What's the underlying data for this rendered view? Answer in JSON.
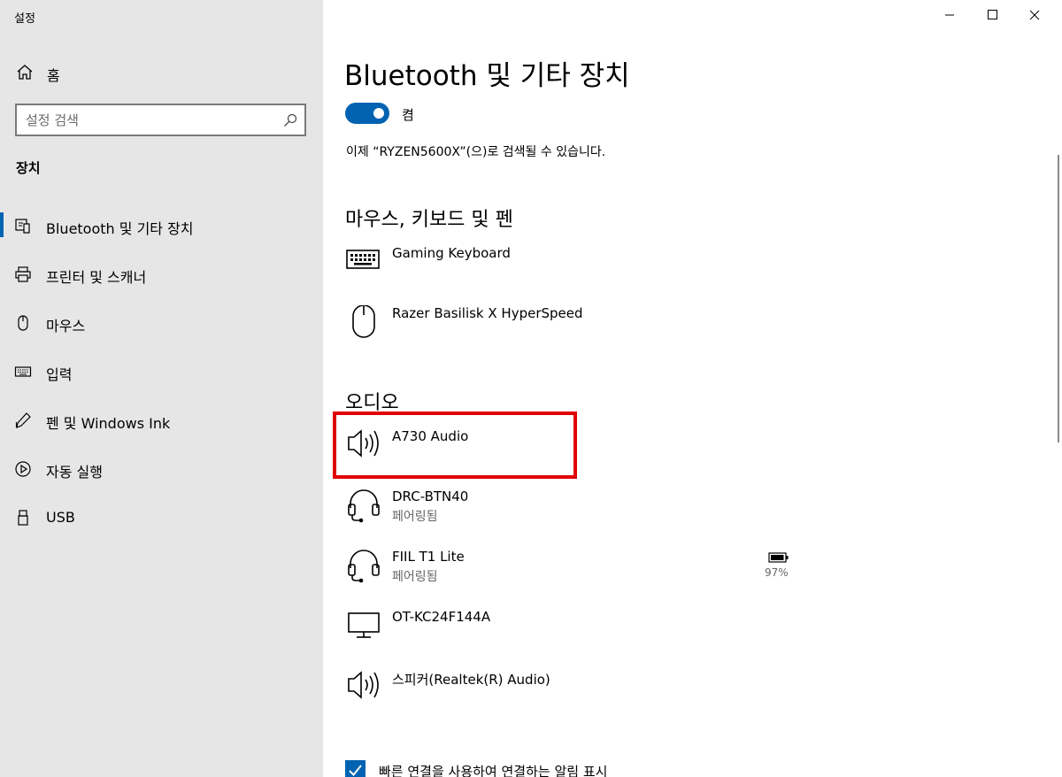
{
  "window": {
    "app_title": "설정"
  },
  "sidebar": {
    "home_label": "홈",
    "search_placeholder": "설정 검색",
    "section_heading": "장치",
    "items": [
      {
        "label": "Bluetooth 및 기타 장치",
        "icon": "bluetooth-devices-icon",
        "active": true
      },
      {
        "label": "프린터 및 스캐너",
        "icon": "printer-icon",
        "active": false
      },
      {
        "label": "마우스",
        "icon": "mouse-icon",
        "active": false
      },
      {
        "label": "입력",
        "icon": "keyboard-icon",
        "active": false
      },
      {
        "label": "펜 및 Windows Ink",
        "icon": "pen-icon",
        "active": false
      },
      {
        "label": "자동 실행",
        "icon": "autoplay-icon",
        "active": false
      },
      {
        "label": "USB",
        "icon": "usb-icon",
        "active": false
      }
    ]
  },
  "main": {
    "title": "Bluetooth 및 기타 장치",
    "bluetooth_toggle": {
      "label": "켬",
      "on": true
    },
    "discoverable_text": "이제 “RYZEN5600X”(으)로 검색될 수 있습니다.",
    "groups": [
      {
        "title": "마우스, 키보드 및 펜",
        "devices": [
          {
            "name": "Gaming Keyboard",
            "status": "",
            "icon": "keyboard-icon"
          },
          {
            "name": "Razer Basilisk X HyperSpeed",
            "status": "",
            "icon": "mouse-icon"
          }
        ]
      },
      {
        "title": "오디오",
        "devices": [
          {
            "name": "A730 Audio",
            "status": "",
            "icon": "speaker-icon",
            "highlighted": true
          },
          {
            "name": "DRC-BTN40",
            "status": "페어링됨",
            "icon": "headset-icon"
          },
          {
            "name": "FIIL T1 Lite",
            "status": "페어링됨",
            "icon": "headset-icon",
            "battery": "97%",
            "battery_level": 0.97
          },
          {
            "name": "OT-KC24F144A",
            "status": "",
            "icon": "monitor-icon"
          },
          {
            "name": "스피커(Realtek(R) Audio)",
            "status": "",
            "icon": "speaker-icon"
          }
        ]
      }
    ],
    "swift_pair": {
      "label": "빠른 연결을 사용하여 연결하는 알림 표시",
      "checked": true
    }
  },
  "colors": {
    "accent": "#0063b1",
    "sidebar_bg": "#e6e6e6",
    "highlight": "#e10000"
  }
}
